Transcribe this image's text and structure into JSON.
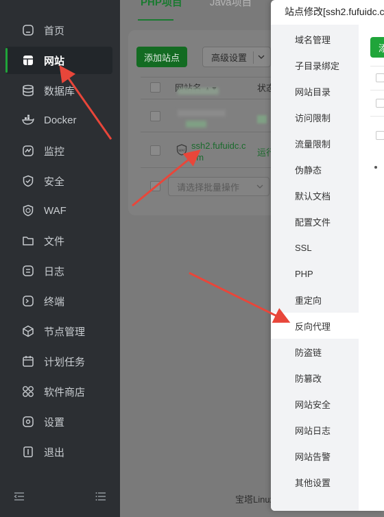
{
  "sidebar": {
    "items": [
      {
        "label": "首页",
        "icon": "home-icon"
      },
      {
        "label": "网站",
        "icon": "website-icon",
        "active": true
      },
      {
        "label": "数据库",
        "icon": "database-icon"
      },
      {
        "label": "Docker",
        "icon": "docker-icon"
      },
      {
        "label": "监控",
        "icon": "monitor-icon"
      },
      {
        "label": "安全",
        "icon": "shield-icon"
      },
      {
        "label": "WAF",
        "icon": "waf-icon"
      },
      {
        "label": "文件",
        "icon": "folder-icon"
      },
      {
        "label": "日志",
        "icon": "log-icon"
      },
      {
        "label": "终端",
        "icon": "terminal-icon"
      },
      {
        "label": "节点管理",
        "icon": "node-icon"
      },
      {
        "label": "计划任务",
        "icon": "calendar-icon"
      },
      {
        "label": "软件商店",
        "icon": "apps-icon"
      },
      {
        "label": "设置",
        "icon": "gear-icon"
      },
      {
        "label": "退出",
        "icon": "logout-icon"
      }
    ]
  },
  "main": {
    "tabs": [
      "PHP项目",
      "Java项目"
    ],
    "add_site_label": "添加站点",
    "advanced_label": "高级设置",
    "columns": {
      "name": "网站名",
      "status": "状态"
    },
    "site": {
      "name": "ssh2.fufuidc.com",
      "status": "运行"
    },
    "batch_placeholder": "请选择批量操作",
    "footer": "宝塔Linux"
  },
  "modal": {
    "title": "站点修改[ssh2.fufuidc.c",
    "menu": [
      "域名管理",
      "子目录绑定",
      "网站目录",
      "访问限制",
      "流量限制",
      "伪静态",
      "默认文档",
      "配置文件",
      "SSL",
      "PHP",
      "重定向",
      "反向代理",
      "防盗链",
      "防篡改",
      "网站安全",
      "网站日志",
      "网站告警",
      "其他设置"
    ],
    "active_index": 11,
    "content_button": "添"
  },
  "colors": {
    "accent": "#20a53a",
    "annotation_arrow": "#e8463a"
  }
}
